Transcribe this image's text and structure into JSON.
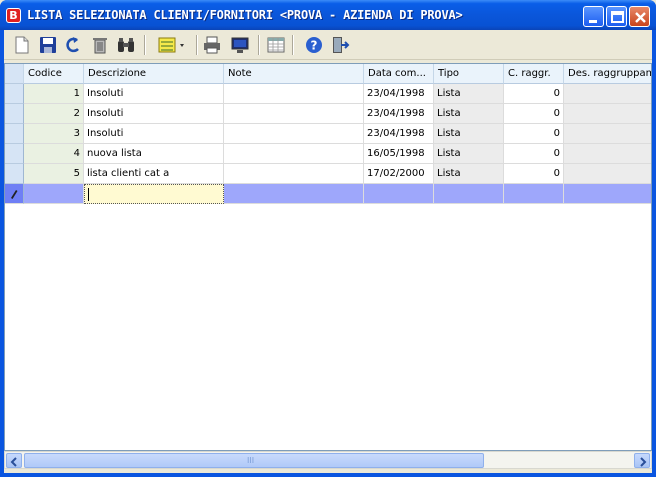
{
  "window": {
    "title": "LISTA SELEZIONATA CLIENTI/FORNITORI <PROVA - AZIENDA DI PROVA>",
    "app_icon_letter": "B"
  },
  "toolbar": {
    "buttons": [
      "new-document-icon",
      "save-icon",
      "undo-icon",
      "delete-icon",
      "find-icon",
      "columns-icon",
      "print-icon",
      "preview-icon",
      "grid-icon",
      "help-icon",
      "exit-icon"
    ]
  },
  "grid": {
    "columns": [
      "Codice",
      "Descrizione",
      "Note",
      "Data com...",
      "Tipo",
      "C. raggr.",
      "Des. raggruppam"
    ],
    "rows": [
      {
        "codice": "1",
        "descrizione": "Insoluti",
        "note": "",
        "data": "23/04/1998",
        "tipo": "Lista",
        "raggr": "0",
        "des": ""
      },
      {
        "codice": "2",
        "descrizione": "Insoluti",
        "note": "",
        "data": "23/04/1998",
        "tipo": "Lista",
        "raggr": "0",
        "des": ""
      },
      {
        "codice": "3",
        "descrizione": "Insoluti",
        "note": "",
        "data": "23/04/1998",
        "tipo": "Lista",
        "raggr": "0",
        "des": ""
      },
      {
        "codice": "4",
        "descrizione": "nuova lista",
        "note": "",
        "data": "16/05/1998",
        "tipo": "Lista",
        "raggr": "0",
        "des": ""
      },
      {
        "codice": "5",
        "descrizione": "lista clienti cat a",
        "note": "",
        "data": "17/02/2000",
        "tipo": "Lista",
        "raggr": "0",
        "des": ""
      }
    ]
  },
  "scrollbar": {
    "grip": "III"
  }
}
